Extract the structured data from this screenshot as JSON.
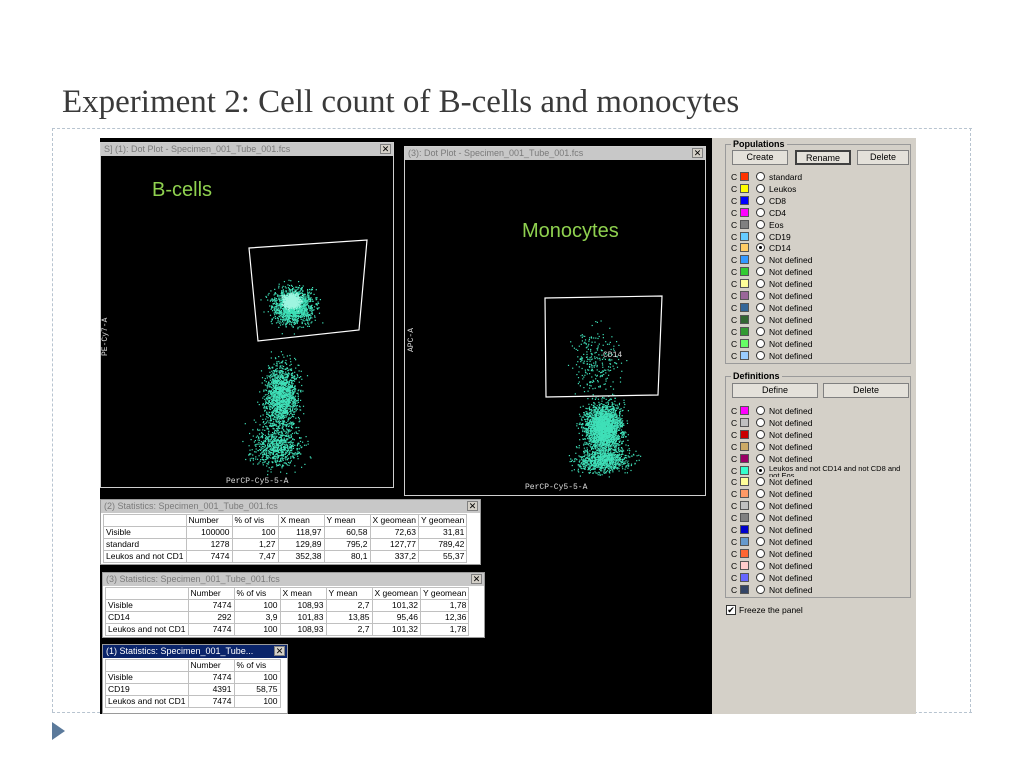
{
  "slide": {
    "title": "Experiment 2: Cell count of B-cells and monocytes"
  },
  "plot1": {
    "window_title": "S] (1): Dot Plot - Specimen_001_Tube_001.fcs",
    "label": "B-cells",
    "x_axis": "PerCP-Cy5-5-A",
    "y_axis": "PE-Cy7-A"
  },
  "plot2": {
    "window_title": "(3): Dot Plot - Specimen_001_Tube_001.fcs",
    "label": "Monocytes",
    "gate_label": "CD14",
    "x_axis": "PerCP-Cy5-5-A",
    "y_axis": "APC-A"
  },
  "stats1": {
    "window_title": "(2) Statistics: Specimen_001_Tube_001.fcs",
    "headers": [
      "",
      "Number",
      "% of vis",
      "X mean",
      "Y mean",
      "X geomean",
      "Y geomean"
    ],
    "rows": [
      [
        "Visible",
        "100000",
        "100",
        "118,97",
        "60,58",
        "72,63",
        "31,81"
      ],
      [
        "standard",
        "1278",
        "1,27",
        "129,89",
        "795,2",
        "127,77",
        "789,42"
      ],
      [
        "Leukos and not CD1",
        "7474",
        "7,47",
        "352,38",
        "80,1",
        "337,2",
        "55,37"
      ]
    ]
  },
  "stats2": {
    "window_title": "(3) Statistics: Specimen_001_Tube_001.fcs",
    "headers": [
      "",
      "Number",
      "% of vis",
      "X mean",
      "Y mean",
      "X geomean",
      "Y geomean"
    ],
    "rows": [
      [
        "Visible",
        "7474",
        "100",
        "108,93",
        "2,7",
        "101,32",
        "1,78"
      ],
      [
        "CD14",
        "292",
        "3,9",
        "101,83",
        "13,85",
        "95,46",
        "12,36"
      ],
      [
        "Leukos and not CD1",
        "7474",
        "100",
        "108,93",
        "2,7",
        "101,32",
        "1,78"
      ]
    ]
  },
  "stats3": {
    "window_title": "(1) Statistics: Specimen_001_Tube...",
    "headers": [
      "",
      "Number",
      "% of vis"
    ],
    "rows": [
      [
        "Visible",
        "7474",
        "100"
      ],
      [
        "CD19",
        "4391",
        "58,75"
      ],
      [
        "Leukos and not CD1",
        "7474",
        "100"
      ]
    ]
  },
  "populations": {
    "title": "Populations",
    "buttons": {
      "create": "Create",
      "rename": "Rename",
      "delete": "Delete"
    },
    "items": [
      {
        "c": "C",
        "color": "#ff3300",
        "label": "standard",
        "selected": false
      },
      {
        "c": "C",
        "color": "#ffff00",
        "label": "Leukos",
        "selected": false
      },
      {
        "c": "C",
        "color": "#0000ff",
        "label": "CD8",
        "selected": false
      },
      {
        "c": "C",
        "color": "#ff00ff",
        "label": "CD4",
        "selected": false
      },
      {
        "c": "C",
        "color": "#808080",
        "label": "Eos",
        "selected": false
      },
      {
        "c": "C",
        "color": "#66ccff",
        "label": "CD19",
        "selected": false
      },
      {
        "c": "C",
        "color": "#ffcc66",
        "label": "CD14",
        "selected": true
      },
      {
        "c": "C",
        "color": "#3399ff",
        "label": "Not defined",
        "selected": false
      },
      {
        "c": "C",
        "color": "#33cc33",
        "label": "Not defined",
        "selected": false
      },
      {
        "c": "C",
        "color": "#ffff99",
        "label": "Not defined",
        "selected": false
      },
      {
        "c": "C",
        "color": "#996699",
        "label": "Not defined",
        "selected": false
      },
      {
        "c": "C",
        "color": "#336699",
        "label": "Not defined",
        "selected": false
      },
      {
        "c": "C",
        "color": "#336633",
        "label": "Not defined",
        "selected": false
      },
      {
        "c": "C",
        "color": "#339933",
        "label": "Not defined",
        "selected": false
      },
      {
        "c": "C",
        "color": "#66ff66",
        "label": "Not defined",
        "selected": false
      },
      {
        "c": "C",
        "color": "#99ccff",
        "label": "Not defined",
        "selected": false
      }
    ]
  },
  "definitions": {
    "title": "Definitions",
    "buttons": {
      "define": "Define",
      "delete": "Delete"
    },
    "items": [
      {
        "c": "C",
        "color": "#ff00ff",
        "label": "Not defined",
        "selected": false
      },
      {
        "c": "C",
        "color": "#c0c0c0",
        "label": "Not defined",
        "selected": false
      },
      {
        "c": "C",
        "color": "#cc0000",
        "label": "Not defined",
        "selected": false
      },
      {
        "c": "C",
        "color": "#ccaa66",
        "label": "Not defined",
        "selected": false
      },
      {
        "c": "C",
        "color": "#990066",
        "label": "Not defined",
        "selected": false
      },
      {
        "c": "C",
        "color": "#33ffcc",
        "label": "Leukos and not CD14 and not CD8 and not Eos",
        "selected": true
      },
      {
        "c": "C",
        "color": "#ffff99",
        "label": "Not defined",
        "selected": false
      },
      {
        "c": "C",
        "color": "#ff9966",
        "label": "Not defined",
        "selected": false
      },
      {
        "c": "C",
        "color": "#c0c0c0",
        "label": "Not defined",
        "selected": false
      },
      {
        "c": "C",
        "color": "#808080",
        "label": "Not defined",
        "selected": false
      },
      {
        "c": "C",
        "color": "#0000cc",
        "label": "Not defined",
        "selected": false
      },
      {
        "c": "C",
        "color": "#6699cc",
        "label": "Not defined",
        "selected": false
      },
      {
        "c": "C",
        "color": "#ff6633",
        "label": "Not defined",
        "selected": false
      },
      {
        "c": "C",
        "color": "#ffcccc",
        "label": "Not defined",
        "selected": false
      },
      {
        "c": "C",
        "color": "#6666ff",
        "label": "Not defined",
        "selected": false
      },
      {
        "c": "C",
        "color": "#334466",
        "label": "Not defined",
        "selected": false
      }
    ]
  },
  "freeze": {
    "label": "Freeze the panel",
    "checked": true
  },
  "colors": {
    "dots": "#3fe0b8",
    "label_green": "#8fd14f",
    "gate": "#ffffff"
  }
}
